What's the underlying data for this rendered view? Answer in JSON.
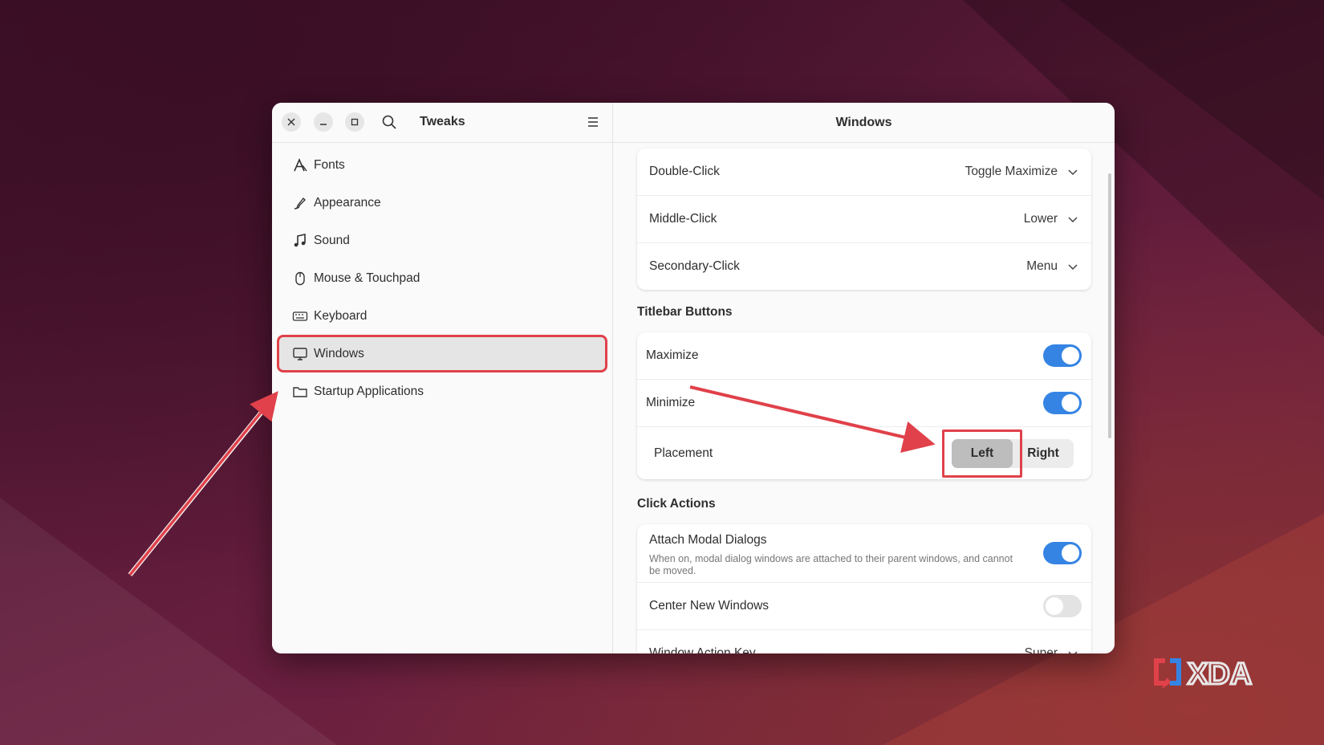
{
  "sidebar": {
    "title": "Tweaks",
    "items": [
      {
        "label": "Fonts",
        "icon": "fonts-icon"
      },
      {
        "label": "Appearance",
        "icon": "appearance-icon"
      },
      {
        "label": "Sound",
        "icon": "music-note-icon"
      },
      {
        "label": "Mouse & Touchpad",
        "icon": "mouse-icon"
      },
      {
        "label": "Keyboard",
        "icon": "keyboard-icon"
      },
      {
        "label": "Windows",
        "icon": "monitor-icon",
        "active": true
      },
      {
        "label": "Startup Applications",
        "icon": "folder-icon"
      }
    ]
  },
  "content": {
    "title": "Windows",
    "actions": [
      {
        "label": "Double-Click",
        "value": "Toggle Maximize"
      },
      {
        "label": "Middle-Click",
        "value": "Lower"
      },
      {
        "label": "Secondary-Click",
        "value": "Menu"
      }
    ],
    "titlebar_buttons": {
      "heading": "Titlebar Buttons",
      "maximize": {
        "label": "Maximize",
        "on": true
      },
      "minimize": {
        "label": "Minimize",
        "on": true
      },
      "placement": {
        "label": "Placement",
        "options": [
          "Left",
          "Right"
        ],
        "selected": "Left"
      }
    },
    "click_actions": {
      "heading": "Click Actions",
      "attach_modal": {
        "label": "Attach Modal Dialogs",
        "description": "When on, modal dialog windows are attached to their parent windows, and cannot be moved.",
        "on": true
      },
      "center_new": {
        "label": "Center New Windows",
        "on": false
      },
      "action_key": {
        "label": "Window Action Key",
        "value": "Super"
      }
    }
  },
  "watermark": "XDA",
  "colors": {
    "accent": "#3584e4",
    "highlight": "#e0414a"
  }
}
